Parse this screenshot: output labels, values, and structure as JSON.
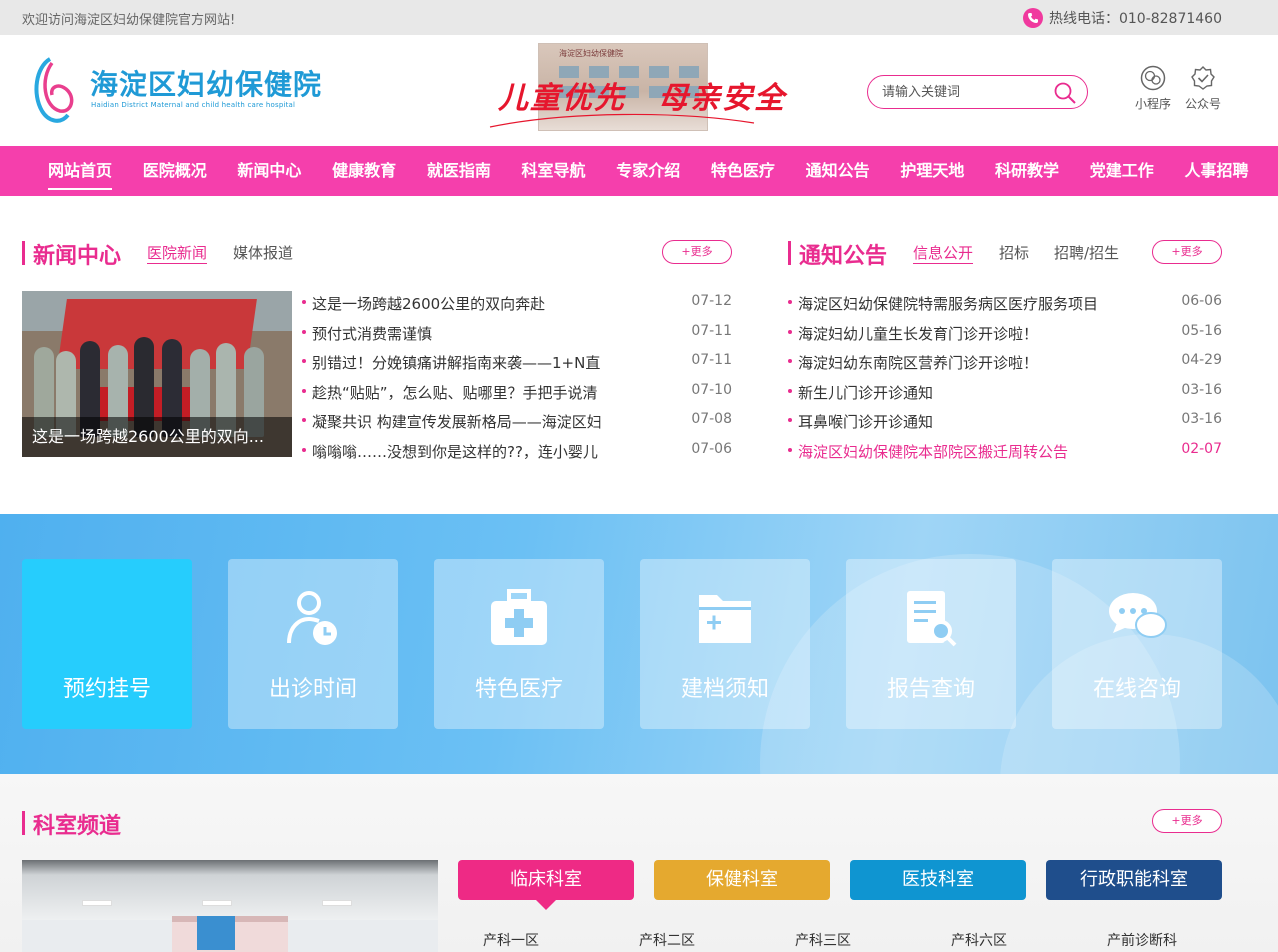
{
  "topbar": {
    "welcome": "欢迎访问海淀区妇幼保健院官方网站!",
    "hotline": "热线电话：010-82871460"
  },
  "header": {
    "logo_title": "海淀区妇幼保健院",
    "logo_subtitle": "Haidian District Maternal and child health care hospital",
    "banner_slogan": "儿童优先　母亲安全",
    "banner_sign": "海淀区妇幼保健院",
    "search_placeholder": "请输入关键词",
    "miniprogram_label": "小程序",
    "official_account_label": "公众号"
  },
  "nav": {
    "items": [
      "网站首页",
      "医院概况",
      "新闻中心",
      "健康教育",
      "就医指南",
      "科室导航",
      "专家介绍",
      "特色医疗",
      "通知公告",
      "护理天地",
      "科研教学",
      "党建工作",
      "人事招聘"
    ]
  },
  "news": {
    "title": "新闻中心",
    "tabs": [
      "医院新闻",
      "媒体报道"
    ],
    "more": "+更多",
    "image_caption": "这是一场跨越2600公里的双向...",
    "items": [
      {
        "title": "这是一场跨越2600公里的双向奔赴",
        "date": "07-12"
      },
      {
        "title": "预付式消费需谨慎",
        "date": "07-11"
      },
      {
        "title": "别错过！分娩镇痛讲解指南来袭——1+N直",
        "date": "07-11"
      },
      {
        "title": "趁热“贴贴”，怎么贴、贴哪里？手把手说清",
        "date": "07-10"
      },
      {
        "title": "凝聚共识 构建宣传发展新格局——海淀区妇",
        "date": "07-08"
      },
      {
        "title": "嗡嗡嗡……没想到你是这样的??，连小婴儿",
        "date": "07-06"
      }
    ]
  },
  "notice": {
    "title": "通知公告",
    "tabs": [
      "信息公开",
      "招标",
      "招聘/招生"
    ],
    "more": "+更多",
    "items": [
      {
        "title": "海淀区妇幼保健院特需服务病区医疗服务项目",
        "date": "06-06"
      },
      {
        "title": "海淀妇幼儿童生长发育门诊开诊啦！",
        "date": "05-16"
      },
      {
        "title": "海淀妇幼东南院区营养门诊开诊啦！",
        "date": "04-29"
      },
      {
        "title": "新生儿门诊开诊通知",
        "date": "03-16"
      },
      {
        "title": "耳鼻喉门诊开诊通知",
        "date": "03-16"
      },
      {
        "title": "海淀区妇幼保健院本部院区搬迁周转公告",
        "date": "02-07"
      }
    ]
  },
  "services": {
    "items": [
      "预约挂号",
      "出诊时间",
      "特色医疗",
      "建档须知",
      "报告查询",
      "在线咨询"
    ]
  },
  "dept": {
    "title": "科室频道",
    "more": "+更多",
    "tabs": [
      "临床科室",
      "保健科室",
      "医技科室",
      "行政职能科室"
    ],
    "tab_colors": [
      "#ee2a85",
      "#e5a92f",
      "#0f95d1",
      "#1f4e8c"
    ],
    "items": [
      "产科一区",
      "产科二区",
      "产科三区",
      "产科六区",
      "产前诊断科"
    ]
  },
  "colors": {
    "accent": "#e92c8f",
    "nav_bg": "#f53fac",
    "logo_blue": "#1f9ad6"
  }
}
